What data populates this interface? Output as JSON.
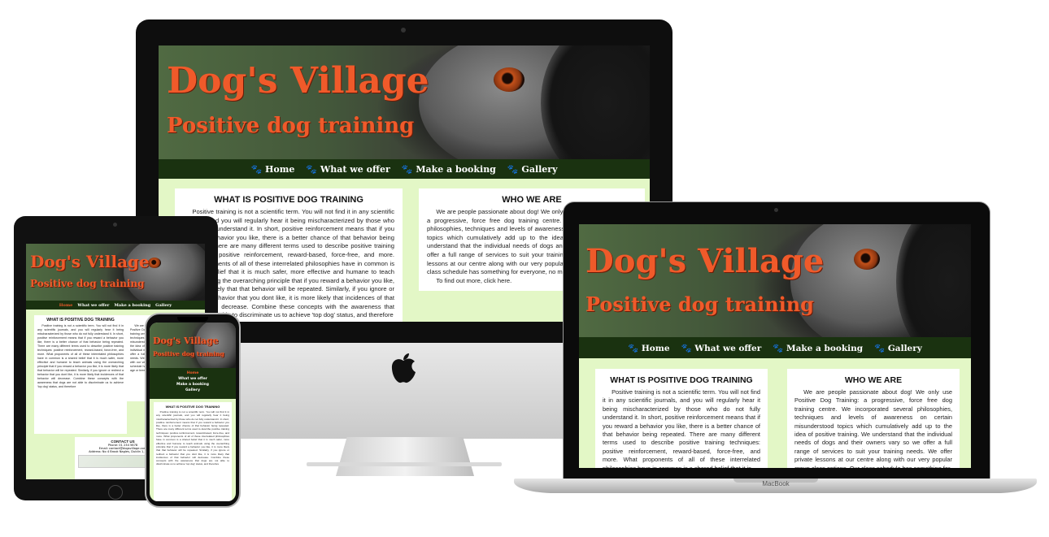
{
  "site": {
    "brand_title": "Dog's Village",
    "brand_tagline": "Positive dog training",
    "nav": [
      "Home",
      "What we offer",
      "Make a booking",
      "Gallery"
    ],
    "sections": {
      "training": {
        "heading": "WHAT IS POSITIVE DOG TRAINING",
        "desktop_text": "Positive training is not a scientific term. You will not find it in any scientific journals, and you will regularly hear it being mischaracterized by those who do not fully understand it. In short, positive reinforcement means that if you reward a behavior you like, there is a better chance of that behavior being repeated. There are many different terms used to describe positive training techniques: positive reinforcement, reward-based, force-free, and more. What proponents of all of these interrelated philosophies have in common is a shared belief that it is much safer, more effective and humane to teach animals using the overarching principle that if you reward a behavior you like, it is more likely that that behavior will be repeated. Similarly, if you ignore or redirect a behavior that you dont like, it is more likely that incidences of that behavior will decrease. Combine these concepts with the awareness that dogs are not able to discriminate us to achieve 'top dog' status, and therefore",
        "laptop_text": "Positive training is not a scientific term. You will not find it in any scientific journals, and you will regularly hear it being mischaracterized by those who do not fully understand it. In short, positive reinforcement means that if you reward a behavior you like, there is a better chance of that behavior being repeated. There are many different terms used to describe positive training techniques: positive reinforcement, reward-based, force-free, and more. What proponents of all of these interrelated philosophies have in common is a shared belief that it is"
      },
      "about": {
        "heading": "WHO WE ARE",
        "desktop_text": "We are people passionate about dog! We only use Positive Dog Training: a progressive, force free dog training centre. We incorporated several philosophies, techniques and levels of awareness on certain misunderstood topics which cumulatively add up to the idea of positive training. We understand that the individual needs of dogs and their owners vary so we offer a full range of services to suit your training needs. We offer private lessons at our centre along with our very popular group class options. Our class schedule has something for everyone, no matter what age or breed.",
        "find_out": "To find out more, click here.",
        "laptop_text": "We are people passionate about dog! We only use Positive Dog Training: a progressive, force free dog training centre. We incorporated several philosophies, techniques and levels of awareness on certain misunderstood topics which cumulatively add up to the idea of positive training. We understand that the individual needs of dogs and their owners vary so we offer a full range of services to suit your training needs. We offer private lessons at our centre along with our very popular group class options. Our class schedule has something for"
      },
      "contact": {
        "heading": "CONTACT US",
        "phone": "Phone: 01 234 5678",
        "email": "Email: contact@dogsvillage.com",
        "address": "Address: No 4 Brook Nagles, Dublin 1, Co. Dub"
      }
    }
  },
  "laptop_label": "MacBook",
  "colors": {
    "brand_orange": "#f05a2a",
    "nav_green": "#1a3210",
    "page_green": "#e3f7c6"
  }
}
